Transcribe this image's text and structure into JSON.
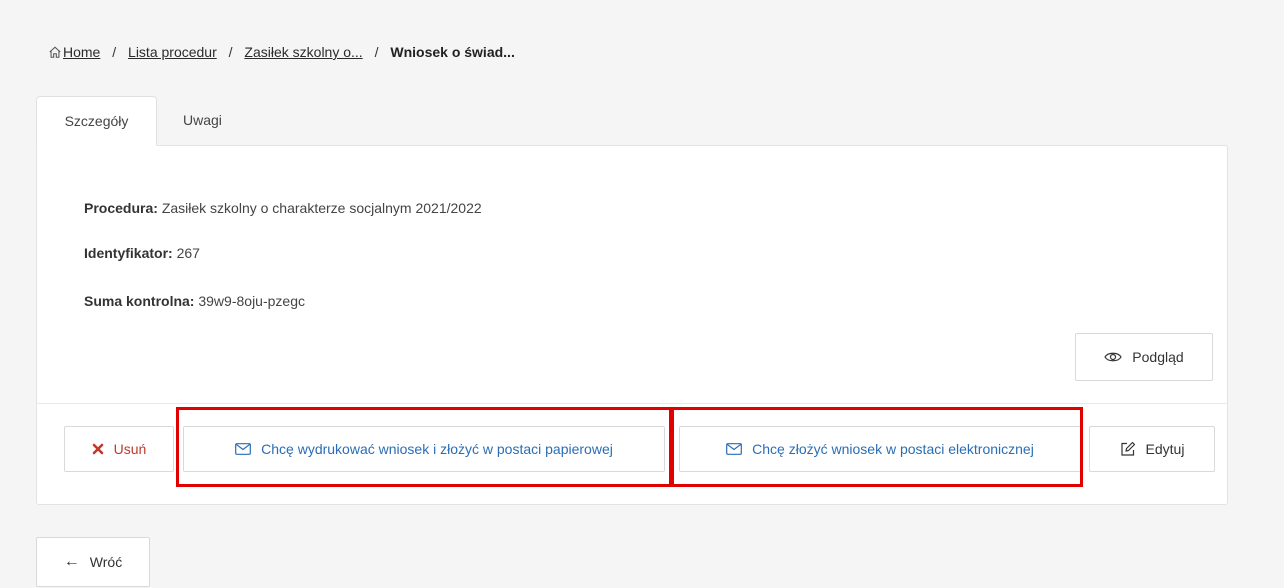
{
  "breadcrumb": {
    "home": "Home",
    "procedures": "Lista procedur",
    "procedure": "Zasiłek szkolny o...",
    "current": "Wniosek o świad..."
  },
  "tabs": [
    {
      "label": "Szczegóły",
      "active": true
    },
    {
      "label": "Uwagi",
      "active": false
    }
  ],
  "details": {
    "procedure_label": "Procedura:",
    "procedure_value": "Zasiłek szkolny o charakterze socjalnym 2021/2022",
    "id_label": "Identyfikator:",
    "id_value": "267",
    "checksum_label": "Suma kontrolna:",
    "checksum_value": "39w9-8oju-pzegc"
  },
  "actions": {
    "preview": "Podgląd",
    "delete": "Usuń",
    "print": "Chcę wydrukować wniosek i złożyć w postaci papierowej",
    "electronic": "Chcę złożyć wniosek w postaci elektronicznej",
    "edit": "Edytuj",
    "back": "Wróć"
  },
  "colors": {
    "primary": "#2a6db5",
    "danger": "#c0392b",
    "highlight": "#e00000"
  },
  "icons": {
    "home": "home-icon",
    "preview": "eye-icon",
    "delete": "x-icon",
    "mail": "envelope-icon",
    "edit": "pencil-square-icon",
    "back": "arrow-left-icon"
  }
}
